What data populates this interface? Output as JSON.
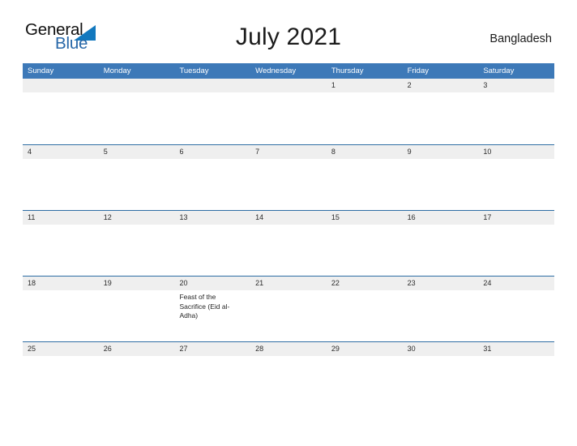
{
  "brand": {
    "name_part1": "General",
    "name_part2": "Blue",
    "triangle_icon": "brand-triangle-icon",
    "colors": {
      "triangle": "#1278be",
      "blue_text": "#2767a8",
      "general_text": "#101010"
    }
  },
  "header": {
    "title": "July 2021",
    "region": "Bangladesh"
  },
  "theme": {
    "header_blue": "#3d79b8",
    "row_divider_blue": "#2e6da4",
    "date_band_gray": "#efefef",
    "page_background": "#ffffff"
  },
  "calendar": {
    "month": "July",
    "year": "2021",
    "weekdays": [
      "Sunday",
      "Monday",
      "Tuesday",
      "Wednesday",
      "Thursday",
      "Friday",
      "Saturday"
    ],
    "weeks": [
      [
        {
          "day": "",
          "event": ""
        },
        {
          "day": "",
          "event": ""
        },
        {
          "day": "",
          "event": ""
        },
        {
          "day": "",
          "event": ""
        },
        {
          "day": "1",
          "event": ""
        },
        {
          "day": "2",
          "event": ""
        },
        {
          "day": "3",
          "event": ""
        }
      ],
      [
        {
          "day": "4",
          "event": ""
        },
        {
          "day": "5",
          "event": ""
        },
        {
          "day": "6",
          "event": ""
        },
        {
          "day": "7",
          "event": ""
        },
        {
          "day": "8",
          "event": ""
        },
        {
          "day": "9",
          "event": ""
        },
        {
          "day": "10",
          "event": ""
        }
      ],
      [
        {
          "day": "11",
          "event": ""
        },
        {
          "day": "12",
          "event": ""
        },
        {
          "day": "13",
          "event": ""
        },
        {
          "day": "14",
          "event": ""
        },
        {
          "day": "15",
          "event": ""
        },
        {
          "day": "16",
          "event": ""
        },
        {
          "day": "17",
          "event": ""
        }
      ],
      [
        {
          "day": "18",
          "event": ""
        },
        {
          "day": "19",
          "event": ""
        },
        {
          "day": "20",
          "event": "Feast of the Sacrifice (Eid al-Adha)"
        },
        {
          "day": "21",
          "event": ""
        },
        {
          "day": "22",
          "event": ""
        },
        {
          "day": "23",
          "event": ""
        },
        {
          "day": "24",
          "event": ""
        }
      ],
      [
        {
          "day": "25",
          "event": ""
        },
        {
          "day": "26",
          "event": ""
        },
        {
          "day": "27",
          "event": ""
        },
        {
          "day": "28",
          "event": ""
        },
        {
          "day": "29",
          "event": ""
        },
        {
          "day": "30",
          "event": ""
        },
        {
          "day": "31",
          "event": ""
        }
      ]
    ]
  }
}
